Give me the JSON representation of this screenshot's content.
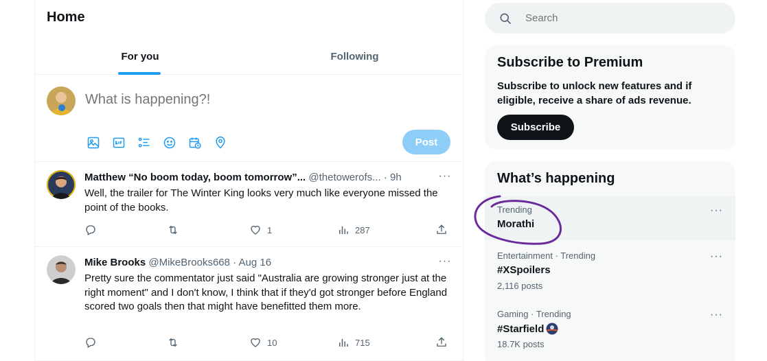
{
  "header": {
    "title": "Home"
  },
  "tabs": [
    {
      "label": "For you",
      "active": true
    },
    {
      "label": "Following",
      "active": false
    }
  ],
  "composer": {
    "placeholder": "What is happening?!",
    "post_label": "Post",
    "icons": [
      "image-icon",
      "gif-icon",
      "poll-icon",
      "emoji-icon",
      "schedule-icon",
      "location-icon"
    ]
  },
  "tweets": [
    {
      "name": "Matthew “No boom today, boom tomorrow”...",
      "handle": "@thetowerofs...",
      "dot": "·",
      "time": "9h",
      "text": "Well, the trailer for The Winter King looks very much like everyone missed the point of the books.",
      "replies": "",
      "reposts": "",
      "likes": "1",
      "views": "287"
    },
    {
      "name": "Mike Brooks",
      "handle": "@MikeBrooks668",
      "dot": "·",
      "time": "Aug 16",
      "text": "Pretty sure the commentator just said \"Australia are growing stronger just at the right moment\" and I don't know, I think that if they'd got stronger before England scored two goals then that might have benefitted them more.",
      "replies": "",
      "reposts": "",
      "likes": "10",
      "views": "715"
    }
  ],
  "search": {
    "placeholder": "Search"
  },
  "premium": {
    "title": "Subscribe to Premium",
    "text": "Subscribe to unlock new features and if eligible, receive a share of ads revenue.",
    "button": "Subscribe"
  },
  "happening": {
    "title": "What’s happening",
    "trends": [
      {
        "meta": "Trending",
        "name": "Morathi",
        "count": ""
      },
      {
        "meta": "Entertainment · Trending",
        "name": "#XSpoilers",
        "count": "2,116 posts"
      },
      {
        "meta": "Gaming · Trending",
        "name": "#Starfield",
        "count": "18.7K posts"
      }
    ]
  },
  "colors": {
    "accent": "#1d9bf0",
    "post_disabled": "#8ecdf8",
    "annotation": "#6b2a9b",
    "text_secondary": "#536471"
  }
}
